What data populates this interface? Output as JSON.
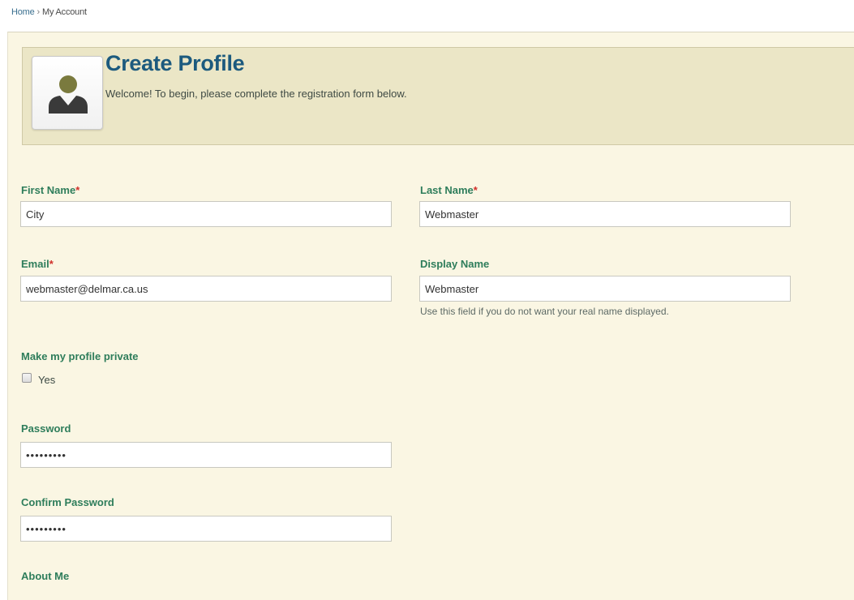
{
  "breadcrumb": {
    "home": "Home",
    "separator": "›",
    "current": "My Account"
  },
  "header": {
    "title": "Create Profile",
    "subtitle": "Welcome! To begin, please complete the registration form below.",
    "avatar_icon": "user-silhouette-icon"
  },
  "form": {
    "first_name": {
      "label": "First Name",
      "required_mark": "*",
      "value": "City"
    },
    "last_name": {
      "label": "Last Name",
      "required_mark": "*",
      "value": "Webmaster"
    },
    "email": {
      "label": "Email",
      "required_mark": "*",
      "value": "webmaster@delmar.ca.us"
    },
    "display_name": {
      "label": "Display Name",
      "value": "Webmaster",
      "hint": "Use this field if you do not want your real name displayed."
    },
    "private": {
      "label": "Make my profile private",
      "option": "Yes",
      "checked": false
    },
    "password": {
      "label": "Password",
      "value": "•••••••••"
    },
    "confirm_password": {
      "label": "Confirm Password",
      "value": "•••••••••"
    },
    "about_me": {
      "label": "About Me"
    }
  },
  "colors": {
    "label_green": "#2e7d5b",
    "title_blue": "#1c5a7e",
    "required_red": "#d0302a",
    "panel_bg": "#faf6e3",
    "header_bg": "#ebe6c6"
  }
}
